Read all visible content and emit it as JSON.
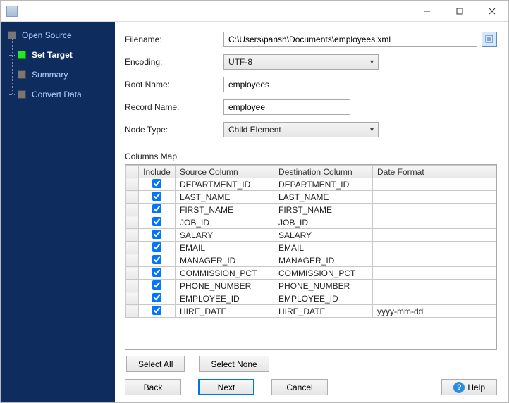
{
  "window": {
    "title": ""
  },
  "sidebar": {
    "steps": [
      {
        "label": "Open Source",
        "current": false
      },
      {
        "label": "Set Target",
        "current": true
      },
      {
        "label": "Summary",
        "current": false
      },
      {
        "label": "Convert Data",
        "current": false
      }
    ]
  },
  "form": {
    "filename_label": "Filename:",
    "filename_value": "C:\\Users\\pansh\\Documents\\employees.xml",
    "encoding_label": "Encoding:",
    "encoding_value": "UTF-8",
    "root_label": "Root Name:",
    "root_value": "employees",
    "record_label": "Record Name:",
    "record_value": "employee",
    "node_label": "Node Type:",
    "node_value": "Child Element",
    "columns_map_label": "Columns Map"
  },
  "table": {
    "headers": {
      "include": "Include",
      "source": "Source Column",
      "destination": "Destination Column",
      "date_format": "Date Format"
    },
    "rows": [
      {
        "include": true,
        "source": "DEPARTMENT_ID",
        "destination": "DEPARTMENT_ID",
        "date_format": ""
      },
      {
        "include": true,
        "source": "LAST_NAME",
        "destination": "LAST_NAME",
        "date_format": ""
      },
      {
        "include": true,
        "source": "FIRST_NAME",
        "destination": "FIRST_NAME",
        "date_format": ""
      },
      {
        "include": true,
        "source": "JOB_ID",
        "destination": "JOB_ID",
        "date_format": ""
      },
      {
        "include": true,
        "source": "SALARY",
        "destination": "SALARY",
        "date_format": ""
      },
      {
        "include": true,
        "source": "EMAIL",
        "destination": "EMAIL",
        "date_format": ""
      },
      {
        "include": true,
        "source": "MANAGER_ID",
        "destination": "MANAGER_ID",
        "date_format": ""
      },
      {
        "include": true,
        "source": "COMMISSION_PCT",
        "destination": "COMMISSION_PCT",
        "date_format": ""
      },
      {
        "include": true,
        "source": "PHONE_NUMBER",
        "destination": "PHONE_NUMBER",
        "date_format": ""
      },
      {
        "include": true,
        "source": "EMPLOYEE_ID",
        "destination": "EMPLOYEE_ID",
        "date_format": ""
      },
      {
        "include": true,
        "source": "HIRE_DATE",
        "destination": "HIRE_DATE",
        "date_format": "yyyy-mm-dd"
      }
    ]
  },
  "buttons": {
    "select_all": "Select All",
    "select_none": "Select None",
    "back": "Back",
    "next": "Next",
    "cancel": "Cancel",
    "help": "Help"
  },
  "icons": {
    "browse": "browse-icon",
    "help": "?"
  }
}
